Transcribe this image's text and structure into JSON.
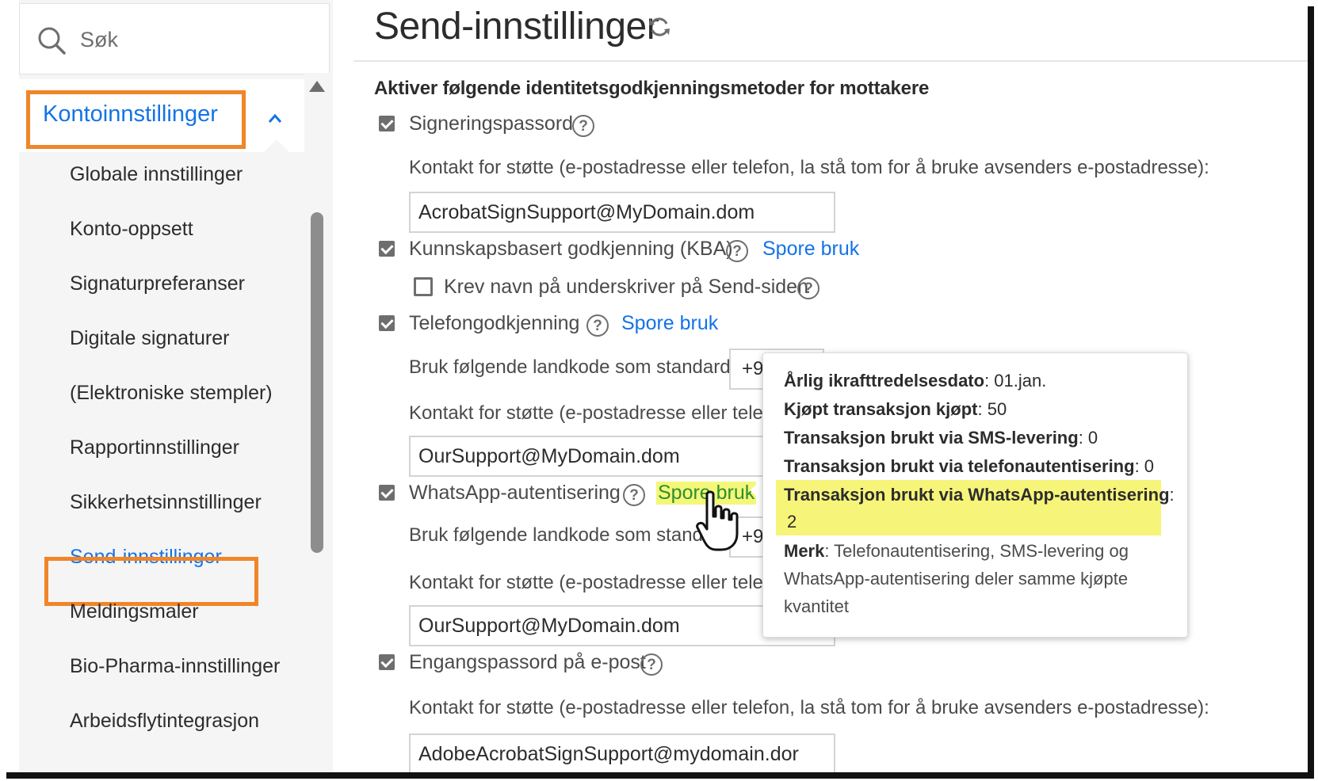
{
  "search": {
    "placeholder": "Søk"
  },
  "sidebar": {
    "section": "Kontoinnstillinger",
    "items": [
      "Globale innstillinger",
      "Konto-oppsett",
      "Signaturpreferanser",
      "Digitale signaturer",
      "(Elektroniske stempler)",
      "Rapportinnstillinger",
      "Sikkerhetsinnstillinger",
      "Send-innstillinger",
      "Meldingsmaler",
      "Bio-Pharma-innstillinger",
      "Arbeidsflytintegrasjon"
    ],
    "active_item": "Send-innstillinger"
  },
  "main": {
    "title": "Send-innstillinger",
    "heading": "Aktiver følgende identitetsgodkjenningsmetoder for mottakere",
    "signing_password": {
      "label": "Signeringspassord",
      "checked": true,
      "support_desc": "Kontakt for støtte (e-postadresse eller telefon, la stå tom for å bruke avsenders e-postadresse):",
      "support_value": "AcrobatSignSupport@MyDomain.dom"
    },
    "kba": {
      "label": "Kunnskapsbasert godkjenning (KBA)",
      "checked": true,
      "track_link": "Spore bruk",
      "require_name_label": "Krev navn på underskriver på Send-siden",
      "require_name_checked": false
    },
    "phone": {
      "label": "Telefongodkjenning",
      "checked": true,
      "track_link": "Spore bruk",
      "country_desc": "Bruk følgende landkode som standard:",
      "country_value": "+9",
      "support_desc": "Kontakt for støtte (e-postadresse eller telefo",
      "support_value": "OurSupport@MyDomain.dom"
    },
    "whatsapp": {
      "label": "WhatsApp-autentisering",
      "checked": true,
      "track_link": "Spore bruk",
      "country_desc": "Bruk følgende landkode som standa",
      "country_value": "+9",
      "support_desc": "Kontakt for støtte (e-postadresse eller telefo",
      "support_value": "OurSupport@MyDomain.dom"
    },
    "email_otp": {
      "label": "Engangspassord på e-post",
      "checked": true,
      "support_desc": "Kontakt for støtte (e-postadresse eller telefon, la stå tom for å bruke avsenders e-postadresse):",
      "support_value": "AdobeAcrobatSignSupport@mydomain.dor"
    }
  },
  "popup": {
    "annual_label": "Årlig ikrafttredelsesdato",
    "annual_value": ": 01.jan.",
    "bought_label": "Kjøpt transaksjon kjøpt",
    "bought_value": ": 50",
    "sms_label": "Transaksjon brukt via SMS-levering",
    "sms_value": ": 0",
    "phone_label": "Transaksjon brukt via telefonautentisering",
    "phone_value": ": 0",
    "whatsapp_label": "Transaksjon brukt via WhatsApp-autentisering",
    "whatsapp_colon": ":",
    "whatsapp_value": "2",
    "note_label": "Merk",
    "note_text": ": Telefonautentisering, SMS-levering og WhatsApp-autentisering deler samme kjøpte kvantitet"
  },
  "colors": {
    "accent": "#1473e6",
    "highlight_box": "#f08529",
    "highlight_band": "#f6f57a"
  }
}
